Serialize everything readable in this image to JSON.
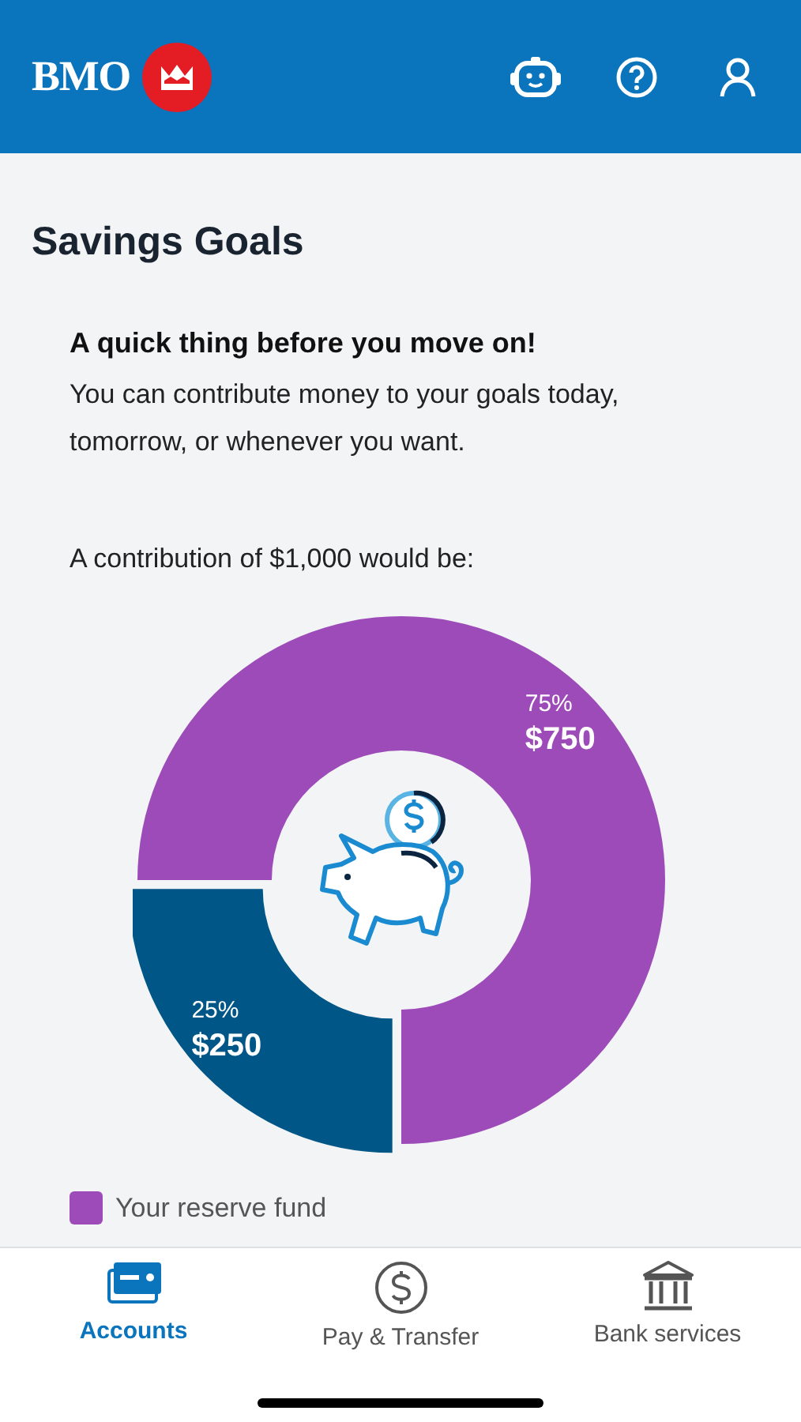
{
  "header": {
    "logo_text": "BMO"
  },
  "page_title": "Savings Goals",
  "notice": {
    "heading": "A quick thing before you move on!",
    "body": "You can contribute money to your goals today, tomorrow, or whenever you want."
  },
  "chart_caption": "A contribution of $1,000 would be:",
  "chart_data": {
    "type": "donut",
    "values": [
      75,
      25
    ]
  },
  "slices": [
    {
      "percent": "75%",
      "amount": "$750",
      "color": "#9c4bb8",
      "exploded": false
    },
    {
      "percent": "25%",
      "amount": "$250",
      "color": "#005687",
      "exploded": true
    }
  ],
  "legend": [
    {
      "label": "Your reserve fund",
      "color": "#9c4bb8"
    }
  ],
  "nav": [
    {
      "label": "Accounts",
      "kind": "card",
      "selected": true
    },
    {
      "label": "Pay & Transfer",
      "kind": "dollar",
      "selected": false
    },
    {
      "label": "Bank services",
      "kind": "bank",
      "selected": false
    }
  ]
}
